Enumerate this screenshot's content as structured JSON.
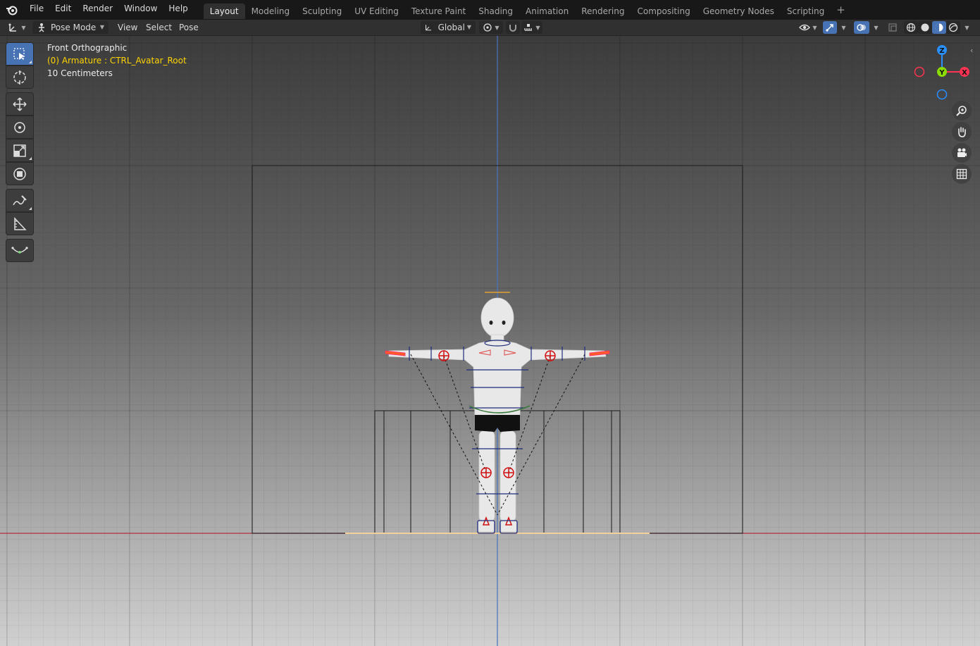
{
  "topbar": {
    "menus": [
      "File",
      "Edit",
      "Render",
      "Window",
      "Help"
    ],
    "workspaces": [
      "Layout",
      "Modeling",
      "Sculpting",
      "UV Editing",
      "Texture Paint",
      "Shading",
      "Animation",
      "Rendering",
      "Compositing",
      "Geometry Nodes",
      "Scripting"
    ],
    "active_workspace": "Layout",
    "add_workspace": "+"
  },
  "header": {
    "mode": "Pose Mode",
    "menus": [
      "View",
      "Select",
      "Pose"
    ],
    "orientation": "Global"
  },
  "viewport": {
    "view_name": "Front Orthographic",
    "active_object": "(0) Armature : CTRL_Avatar_Root",
    "grid_scale": "10 Centimeters",
    "gizmo": {
      "z": "Z",
      "y": "Y",
      "x": "X"
    },
    "colors": {
      "x_axis": "#ff3352",
      "y_axis": "#8bdc00",
      "z_axis": "#2890ff",
      "accent": "#4772b3",
      "annotation_yellow": "#ffd400"
    }
  },
  "tools": [
    "select-box-tool",
    "cursor-tool",
    "move-tool",
    "rotate-tool",
    "scale-tool",
    "transform-tool",
    "annotate-tool",
    "measure-tool",
    "relax-tool"
  ]
}
